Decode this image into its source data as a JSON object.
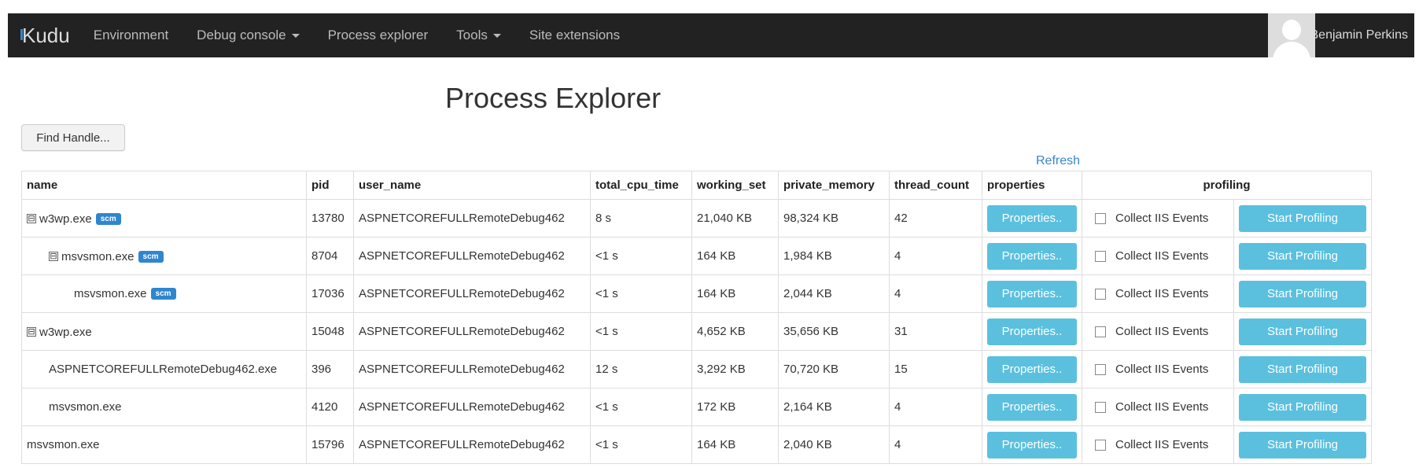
{
  "navbar": {
    "brand": "Kudu",
    "items": [
      {
        "label": "Environment",
        "dropdown": false
      },
      {
        "label": "Debug console",
        "dropdown": true
      },
      {
        "label": "Process explorer",
        "dropdown": false
      },
      {
        "label": "Tools",
        "dropdown": true
      },
      {
        "label": "Site extensions",
        "dropdown": false
      }
    ],
    "user": "Benjamin Perkins",
    "avatar_icon": "user-avatar-icon"
  },
  "page": {
    "title": "Process Explorer",
    "find_handle_label": "Find Handle...",
    "refresh_label": "Refresh"
  },
  "table": {
    "headers": [
      "name",
      "pid",
      "user_name",
      "total_cpu_time",
      "working_set",
      "private_memory",
      "thread_count",
      "properties",
      "profiling"
    ],
    "properties_label": "Properties..",
    "collect_label": "Collect IIS Events",
    "profile_label": "Start Profiling",
    "badge_label": "scm",
    "rows": [
      {
        "name": "w3wp.exe",
        "level": 0,
        "toggle": "⊟",
        "scm": true,
        "pid": "13780",
        "user_name": "ASPNETCOREFULLRemoteDebug462",
        "cpu": "8 s",
        "ws": "21,040 KB",
        "pm": "98,324 KB",
        "threads": "42"
      },
      {
        "name": "msvsmon.exe",
        "level": 1,
        "toggle": "⊟",
        "scm": true,
        "pid": "8704",
        "user_name": "ASPNETCOREFULLRemoteDebug462",
        "cpu": "<1 s",
        "ws": "164 KB",
        "pm": "1,984 KB",
        "threads": "4"
      },
      {
        "name": "msvsmon.exe",
        "level": 2,
        "toggle": "",
        "scm": true,
        "pid": "17036",
        "user_name": "ASPNETCOREFULLRemoteDebug462",
        "cpu": "<1 s",
        "ws": "164 KB",
        "pm": "2,044 KB",
        "threads": "4"
      },
      {
        "name": "w3wp.exe",
        "level": 0,
        "toggle": "⊟",
        "scm": false,
        "pid": "15048",
        "user_name": "ASPNETCOREFULLRemoteDebug462",
        "cpu": "<1 s",
        "ws": "4,652 KB",
        "pm": "35,656 KB",
        "threads": "31"
      },
      {
        "name": "ASPNETCOREFULLRemoteDebug462.exe",
        "level": 1,
        "toggle": "",
        "scm": false,
        "pid": "396",
        "user_name": "ASPNETCOREFULLRemoteDebug462",
        "cpu": "12 s",
        "ws": "3,292 KB",
        "pm": "70,720 KB",
        "threads": "15"
      },
      {
        "name": "msvsmon.exe",
        "level": 1,
        "toggle": "",
        "scm": false,
        "pid": "4120",
        "user_name": "ASPNETCOREFULLRemoteDebug462",
        "cpu": "<1 s",
        "ws": "172 KB",
        "pm": "2,164 KB",
        "threads": "4"
      },
      {
        "name": "msvsmon.exe",
        "level": 0,
        "toggle": "",
        "scm": false,
        "pid": "15796",
        "user_name": "ASPNETCOREFULLRemoteDebug462",
        "cpu": "<1 s",
        "ws": "164 KB",
        "pm": "2,040 KB",
        "threads": "4"
      }
    ]
  },
  "colors": {
    "navbar": "#222222",
    "accent": "#5bc0de",
    "badge": "#2f86cf",
    "link": "#3a86c8"
  }
}
